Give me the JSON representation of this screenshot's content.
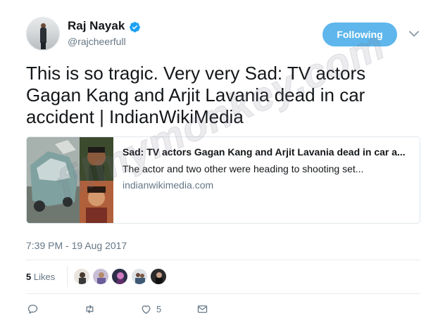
{
  "author": {
    "display_name": "Raj Nayak",
    "handle": "@rajcheerfull",
    "verified_icon": "verified-badge-icon",
    "avatar_icon": "profile-avatar"
  },
  "follow_button": {
    "label": "Following"
  },
  "menu_icon": "chevron-down-icon",
  "tweet": {
    "text": "This is so tragic. Very very Sad: TV actors Gagan Kang and Arjit Lavania dead in car accident | IndianWikiMedia"
  },
  "card": {
    "title": "Sad: TV actors Gagan Kang and Arjit Lavania dead in car a...",
    "description": "The actor and two other were heading to shooting set...",
    "domain": "indianwikimedia.com"
  },
  "timestamp": "7:39 PM - 19 Aug 2017",
  "likes": {
    "count": "5",
    "label": "Likes",
    "likers_count": 5
  },
  "actions": {
    "reply_icon": "reply-icon",
    "retweet_icon": "retweet-icon",
    "like_icon": "heart-icon",
    "like_count": "5",
    "dm_icon": "envelope-icon"
  },
  "watermark": "filmymonkey.com",
  "colors": {
    "brand_blue": "#1da1f2",
    "follow_button": "#5eb6ec",
    "secondary_text": "#657786",
    "primary_text": "#14171a",
    "divider": "#e6ecf0"
  }
}
